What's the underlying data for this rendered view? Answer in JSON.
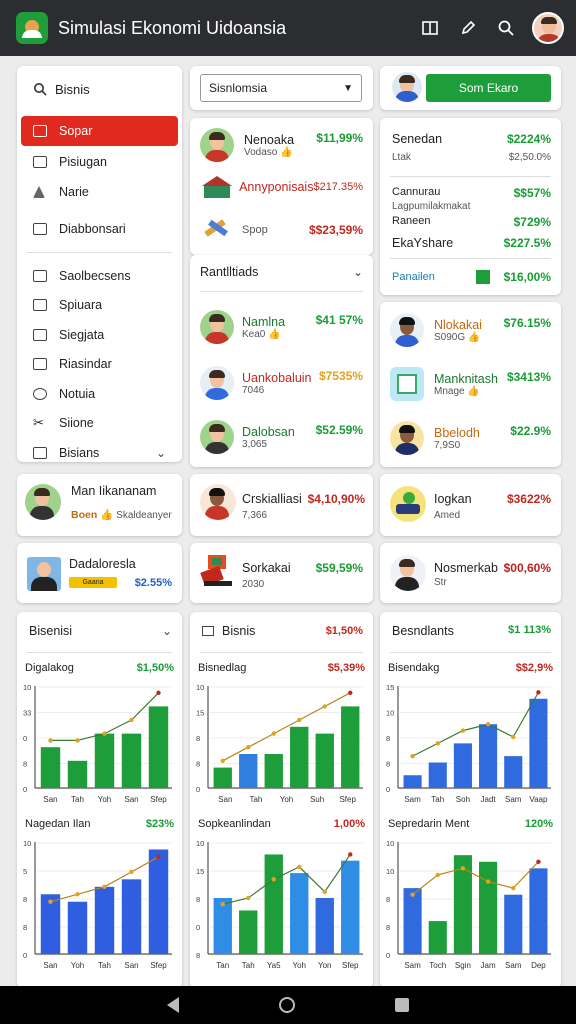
{
  "app": {
    "title": "Simulasi Ekonomi Uidoansia"
  },
  "topbar": {
    "icons": [
      "book-icon",
      "edit-icon",
      "search-icon",
      "avatar"
    ]
  },
  "sidebar": {
    "search_label": "Bisnis",
    "items": [
      {
        "label": "Sopar",
        "icon": "warning-icon",
        "active": true
      },
      {
        "label": "Pisiugan",
        "icon": "folder-icon"
      },
      {
        "label": "Narie",
        "icon": "triangle-icon"
      },
      {
        "label": "Diabbonsari",
        "icon": "card-icon"
      },
      {
        "label": "Saolbecsens",
        "icon": "dashboard-icon"
      },
      {
        "label": "Spiuara",
        "icon": "checkbox-icon"
      },
      {
        "label": "Siegjata",
        "icon": "checkbox-icon"
      },
      {
        "label": "Riasindar",
        "icon": "briefcase-icon"
      },
      {
        "label": "Notuia",
        "icon": "person-icon"
      },
      {
        "label": "Siione",
        "icon": "scissors-icon"
      },
      {
        "label": "Bisians",
        "icon": "external-icon"
      }
    ]
  },
  "col2": {
    "select_value": "Sisnlomsia",
    "rows": [
      {
        "name": "Nenoaka",
        "sub": "Vodaso",
        "value": "$11,99%",
        "color": "green"
      },
      {
        "name": "Annyponisais",
        "sub": "",
        "value": "$217.35%",
        "color": "red"
      },
      {
        "name": "Spop",
        "sub": "",
        "value": "$$23,59%",
        "color": "red"
      }
    ],
    "section_label": "Rantlltiads",
    "people": [
      {
        "name": "Namlna",
        "sub": "Kea0",
        "value": "$41 57%",
        "color": "green"
      },
      {
        "name": "Uankobaluin",
        "sub": "7046",
        "value": "$7535%",
        "color": "orange"
      },
      {
        "name": "Dalobsan",
        "sub": "3,065",
        "value": "$52.59%",
        "color": "green"
      }
    ]
  },
  "col3": {
    "button_label": "Som Ekaro",
    "stats": [
      {
        "label": "Senedan",
        "value": "$2224%",
        "color": "green"
      },
      {
        "label": "Ltak",
        "value": "$2,50.0%",
        "color": "gray"
      },
      {
        "label": "Cannurau",
        "value": "$$57%",
        "color": "green"
      },
      {
        "label": "Lagpumilakmakat",
        "value": "",
        "color": "gray"
      },
      {
        "label": "Raneen",
        "value": "$729%",
        "color": "green"
      },
      {
        "label": "EkaYshare",
        "value": "$227.5%",
        "color": "green"
      },
      {
        "label": "Panailen",
        "value": "$16,00%",
        "color": "green"
      }
    ],
    "people": [
      {
        "name": "Nlokakai",
        "sub": "S090G",
        "value": "$76.15%",
        "color": "green"
      },
      {
        "name": "Manknitash",
        "sub": "Mnage",
        "value": "$3413%",
        "color": "green"
      },
      {
        "name": "Bbelodh",
        "sub": "7,9S0",
        "value": "$22.9%",
        "color": "green"
      }
    ]
  },
  "mid_cards": [
    {
      "name": "Man Iikananam",
      "sub": "Boen",
      "sub2": "Skaldeanyer",
      "value": ""
    },
    {
      "name": "Crskialliasi",
      "sub": "7,366",
      "value": "$4,10,90%",
      "color": "red"
    },
    {
      "name": "Iogkan",
      "sub": "Amed",
      "value": "$3622%",
      "color": "red"
    },
    {
      "name": "Dadaloresla",
      "badge": "Gaana",
      "value": "$2.55%",
      "color": "blue"
    },
    {
      "name": "Sorkakai",
      "sub": "2030",
      "value": "$59,59%",
      "color": "green"
    },
    {
      "name": "Nosmerkab",
      "sub": "Str",
      "value": "$00,60%",
      "color": "red"
    }
  ],
  "panels": [
    {
      "title": "Bisenisi",
      "value": "",
      "dropdown": true
    },
    {
      "title": "Bisnis",
      "value": "$1,50%",
      "color": "red"
    },
    {
      "title": "Besndlants",
      "value": "$1 113%",
      "color": "green"
    }
  ],
  "chart_data": [
    {
      "type": "bar",
      "title": "Digalakog",
      "headline": "$1,50%",
      "categories": [
        "San",
        "Tah",
        "Yoh",
        "San",
        "Sfep"
      ],
      "values": [
        6,
        4,
        8,
        8,
        12
      ],
      "line": [
        7,
        7,
        8,
        10,
        14
      ],
      "colors": [
        "#1e9e3a",
        "#1e9e3a",
        "#1e9e3a",
        "#1e9e3a",
        "#1e9e3a"
      ],
      "yticks": [
        "10",
        "33",
        "0",
        "8",
        "0"
      ],
      "ylim": [
        0,
        15
      ]
    },
    {
      "type": "bar",
      "title": "Bisnedlag",
      "headline": "$5,39%",
      "categories": [
        "San",
        "Tah",
        "Yoh",
        "Suh",
        "Sfep"
      ],
      "values": [
        3,
        5,
        5,
        9,
        8,
        12
      ],
      "line": [
        4,
        6,
        8,
        10,
        12,
        14
      ],
      "colors": [
        "#1e9e3a",
        "#2f7ee0",
        "#1e9e3a",
        "#1e9e3a",
        "#1e9e3a",
        "#1e9e3a"
      ],
      "yticks": [
        "10",
        "15",
        "8",
        "8",
        "0"
      ],
      "ylim": [
        0,
        15
      ]
    },
    {
      "type": "bar",
      "title": "Bisendakg",
      "headline": "$$2,9%",
      "categories": [
        "Sam",
        "Tah",
        "Soh",
        "Jadt",
        "Sam",
        "Vaap"
      ],
      "values": [
        2,
        4,
        7,
        10,
        5,
        14
      ],
      "line": [
        5,
        7,
        9,
        10,
        8,
        15
      ],
      "colors": [
        "#2f6bdf",
        "#2f6bdf",
        "#2f6bdf",
        "#2f6bdf",
        "#2f6bdf",
        "#2f6bdf"
      ],
      "yticks": [
        "15",
        "10",
        "8",
        "8",
        "0"
      ],
      "ylim": [
        0,
        16
      ]
    },
    {
      "type": "bar",
      "title": "Nagedan Ilan",
      "headline": "$23%",
      "categories": [
        "San",
        "Yoh",
        "Tah",
        "San",
        "Sfep"
      ],
      "values": [
        8,
        7,
        9,
        10,
        14
      ],
      "line": [
        7,
        8,
        9,
        11,
        13
      ],
      "colors": [
        "#2f5fe0",
        "#2f5fe0",
        "#2f5fe0",
        "#2f5fe0",
        "#2f5fe0"
      ],
      "yticks": [
        "10",
        "5",
        "8",
        "8",
        "0"
      ],
      "ylim": [
        0,
        15
      ]
    },
    {
      "type": "bar",
      "title": "Sopkeanlindan",
      "headline": "1,00%",
      "categories": [
        "Tan",
        "Tah",
        "Ya5",
        "Yoh",
        "Yon",
        "Sfep"
      ],
      "values": [
        9,
        7,
        16,
        13,
        9,
        15
      ],
      "line": [
        8,
        9,
        12,
        14,
        10,
        16
      ],
      "colors": [
        "#2f8de6",
        "#1e9e3a",
        "#1e9e3a",
        "#2f8de6",
        "#2f6bdf",
        "#2f8de6"
      ],
      "yticks": [
        "10",
        "15",
        "8",
        "0",
        "8"
      ],
      "ylim": [
        0,
        18
      ]
    },
    {
      "type": "bar",
      "title": "Sepredarin Ment",
      "headline": "120%",
      "categories": [
        "Sam",
        "Toch",
        "Sgin",
        "Jam",
        "Sam",
        "Dep"
      ],
      "values": [
        10,
        5,
        15,
        14,
        9,
        13
      ],
      "line": [
        9,
        12,
        13,
        11,
        10,
        14
      ],
      "colors": [
        "#2f6bdf",
        "#1e9e3a",
        "#1e9e3a",
        "#1e9e3a",
        "#2f6bdf",
        "#2f6bdf"
      ],
      "yticks": [
        "10",
        "10",
        "8",
        "8",
        "0"
      ],
      "ylim": [
        0,
        17
      ]
    }
  ],
  "colors": {
    "green": "#1a9c35",
    "red": "#c0281e",
    "blue": "#1f5fc9",
    "topbar": "#2b2d31",
    "accent_red": "#e02a20"
  }
}
